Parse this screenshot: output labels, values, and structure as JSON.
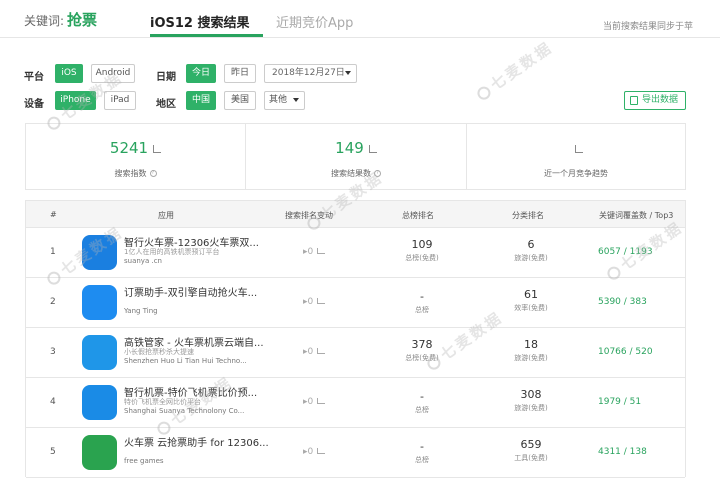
{
  "header": {
    "keyword_label": "关键词:",
    "keyword": "抢票",
    "tabs": [
      {
        "label": "iOS12 搜索结果",
        "active": true
      },
      {
        "label": "近期竞价App",
        "active": false
      }
    ],
    "sync_note": "当前搜索结果同步于苹"
  },
  "filters": {
    "platform_label": "平台",
    "platforms": [
      {
        "label": "iOS",
        "active": true
      },
      {
        "label": "Android",
        "active": false
      }
    ],
    "date_label": "日期",
    "dates": [
      {
        "label": "今日",
        "active": true
      },
      {
        "label": "昨日",
        "active": false
      }
    ],
    "date_value": "2018年12月27日",
    "device_label": "设备",
    "devices": [
      {
        "label": "iPhone",
        "active": true
      },
      {
        "label": "iPad",
        "active": false
      }
    ],
    "region_label": "地区",
    "regions": [
      {
        "label": "中国",
        "active": true
      },
      {
        "label": "美国",
        "active": false
      }
    ],
    "region_other": "其他",
    "export_label": "导出数据"
  },
  "stats": [
    {
      "value": "5241",
      "label": "搜索指数"
    },
    {
      "value": "149",
      "label": "搜索结果数"
    },
    {
      "value": "",
      "label": "近一个月竞争趋势"
    }
  ],
  "table": {
    "headers": [
      "#",
      "应用",
      "搜索排名变动",
      "总榜排名",
      "分类排名",
      "关键词覆盖数 / Top3"
    ],
    "rows": [
      {
        "index": "1",
        "name": "智行火车票-12306火车票双...",
        "desc": "1亿人在用的高铁机票预订平台",
        "developer": "suanya .cn",
        "change": "0",
        "total": "109",
        "total_sub": "总榜(免费)",
        "category": "6",
        "category_sub": "旅游(免费)",
        "keywords": "6057 / 1193",
        "icon_color": "#1a7fe0"
      },
      {
        "index": "2",
        "name": "订票助手-双引擎自动抢火车...",
        "desc": "",
        "developer": "Yang Ting",
        "change": "0",
        "total": "-",
        "total_sub": "总榜",
        "category": "61",
        "category_sub": "效率(免费)",
        "keywords": "5390 / 383",
        "icon_color": "#1e8cf0"
      },
      {
        "index": "3",
        "name": "高铁管家 - 火车票机票云端自...",
        "desc": "小长假抢票秒杀大提速",
        "developer": "Shenzhen Huo Li Tian Hui Techno...",
        "change": "0",
        "total": "378",
        "total_sub": "总榜(免费)",
        "category": "18",
        "category_sub": "旅游(免费)",
        "keywords": "10766 / 520",
        "icon_color": "#1f96e8"
      },
      {
        "index": "4",
        "name": "智行机票-特价飞机票比价预...",
        "desc": "特价飞机票全网比价平台",
        "developer": "Shanghai Suanya Technolony Co...",
        "change": "0",
        "total": "-",
        "total_sub": "总榜",
        "category": "308",
        "category_sub": "旅游(免费)",
        "keywords": "1979 / 51",
        "icon_color": "#1a8be6"
      },
      {
        "index": "5",
        "name": "火车票 云抢票助手 for 12306...",
        "desc": "",
        "developer": "free games",
        "change": "0",
        "total": "-",
        "total_sub": "总榜",
        "category": "659",
        "category_sub": "工具(免费)",
        "keywords": "4311 / 138",
        "icon_color": "#2aa34f"
      }
    ]
  },
  "watermark": "七麦数据"
}
